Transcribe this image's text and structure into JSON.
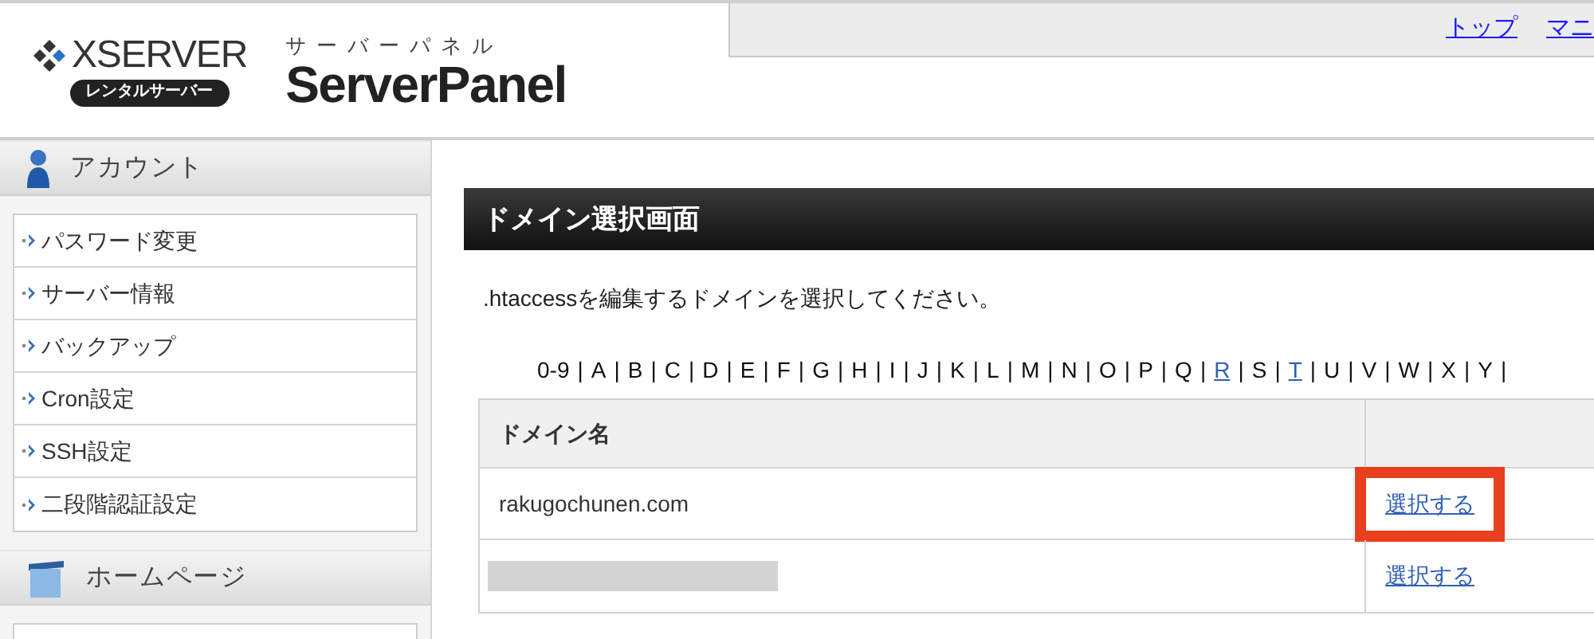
{
  "logo": {
    "brand": "XSERVER",
    "badge": "レンタルサーバー",
    "subtitle": "サーバーパネル",
    "product": "ServerPanel"
  },
  "nav_links": [
    "トップ",
    "マニ"
  ],
  "sidebar": {
    "sections": [
      {
        "title": "アカウント",
        "items": [
          "パスワード変更",
          "サーバー情報",
          "バックアップ",
          "Cron設定",
          "SSH設定",
          "二段階認証設定"
        ]
      },
      {
        "title": "ホームページ"
      }
    ]
  },
  "main": {
    "title": "ドメイン選択画面",
    "instruction": ".htaccessを編集するドメインを選択してください。",
    "alphabet": {
      "separator": "|",
      "items": [
        {
          "label": "0-9",
          "linked": false
        },
        {
          "label": "A",
          "linked": false
        },
        {
          "label": "B",
          "linked": false
        },
        {
          "label": "C",
          "linked": false
        },
        {
          "label": "D",
          "linked": false
        },
        {
          "label": "E",
          "linked": false
        },
        {
          "label": "F",
          "linked": false
        },
        {
          "label": "G",
          "linked": false
        },
        {
          "label": "H",
          "linked": false
        },
        {
          "label": "I",
          "linked": false
        },
        {
          "label": "J",
          "linked": false
        },
        {
          "label": "K",
          "linked": false
        },
        {
          "label": "L",
          "linked": false
        },
        {
          "label": "M",
          "linked": false
        },
        {
          "label": "N",
          "linked": false
        },
        {
          "label": "O",
          "linked": false
        },
        {
          "label": "P",
          "linked": false
        },
        {
          "label": "Q",
          "linked": false
        },
        {
          "label": "R",
          "linked": true
        },
        {
          "label": "S",
          "linked": false
        },
        {
          "label": "T",
          "linked": true
        },
        {
          "label": "U",
          "linked": false
        },
        {
          "label": "V",
          "linked": false
        },
        {
          "label": "W",
          "linked": false
        },
        {
          "label": "X",
          "linked": false
        },
        {
          "label": "Y",
          "linked": false
        }
      ]
    },
    "table": {
      "columns": [
        "ドメイン名"
      ],
      "rows": [
        {
          "domain": "rakugochunen.com",
          "redacted": false,
          "action": "選択する",
          "highlighted": true
        },
        {
          "redacted": true,
          "action": "選択する",
          "highlighted": false
        }
      ]
    }
  }
}
